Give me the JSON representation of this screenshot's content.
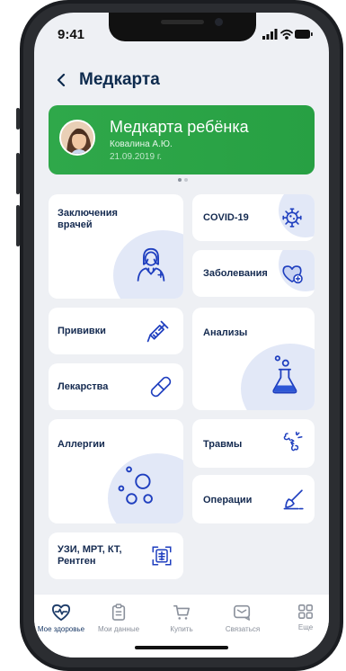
{
  "status": {
    "time": "9:41"
  },
  "header": {
    "title": "Медкарта"
  },
  "banner": {
    "title": "Медкарта ребёнка",
    "name": "Ковалина А.Ю.",
    "date": "21.09.2019 г."
  },
  "tiles": {
    "doctors": "Заключения врачей",
    "covid": "COVID-19",
    "diseases": "Заболевания",
    "vaccines": "Прививки",
    "analyses": "Анализы",
    "medicines": "Лекарства",
    "allergies": "Аллергии",
    "injuries": "Травмы",
    "operations": "Операции",
    "scans": "УЗИ, МРТ, КТ, Рентген"
  },
  "tabbar": [
    {
      "label": "Мое здоровье",
      "icon": "heart-pulse-icon",
      "active": true
    },
    {
      "label": "Мои данные",
      "icon": "clipboard-icon"
    },
    {
      "label": "Купить",
      "icon": "cart-icon"
    },
    {
      "label": "Связаться",
      "icon": "chat-icon"
    },
    {
      "label": "Еще",
      "icon": "grid-icon"
    }
  ],
  "colors": {
    "accent": "#2fa84a",
    "navy": "#142a50",
    "icon": "#1f3fbf",
    "background": "#eef0f4"
  }
}
